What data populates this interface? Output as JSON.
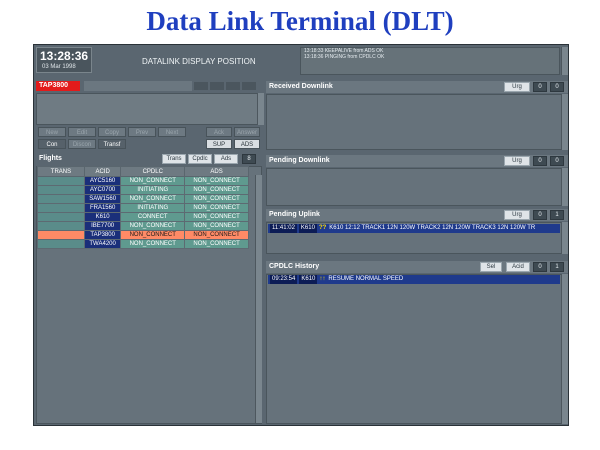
{
  "slide": {
    "title": "Data Link Terminal (DLT)"
  },
  "clock": {
    "time": "13:28:36",
    "date": "03 Mar 1998"
  },
  "display_title": "DATALINK DISPLAY POSITION",
  "log_lines": [
    "13:18:33 KEEPALIVE from ADS OK",
    "13:18:36 PINGING from CPDLC OK"
  ],
  "flight_tag": "TAP3800",
  "buttons": {
    "row1": [
      "New",
      "Edit",
      "Copy",
      "Prev",
      "Next"
    ],
    "row1_right": [
      "Ack",
      "Answer"
    ],
    "row2": [
      "Con",
      "Discon",
      "Transf"
    ],
    "row2_right": [
      "SUP",
      "ADS"
    ]
  },
  "flights": {
    "title": "Flights",
    "controls": [
      "Trans",
      "Cpdlc",
      "Ads"
    ],
    "count": "8",
    "columns": [
      "TRANS",
      "ACID",
      "CPDLC",
      "ADS"
    ],
    "rows": [
      {
        "trans": "",
        "acid": "AYC5160",
        "cpdlc": "NON_CONNECT",
        "ads": "NON_CONNECT",
        "selected": false
      },
      {
        "trans": "",
        "acid": "AYC0700",
        "cpdlc": "INITIATING",
        "ads": "NON_CONNECT",
        "selected": false
      },
      {
        "trans": "",
        "acid": "SAW1560",
        "cpdlc": "NON_CONNECT",
        "ads": "NON_CONNECT",
        "selected": false
      },
      {
        "trans": "",
        "acid": "FRA1560",
        "cpdlc": "INITIATING",
        "ads": "NON_CONNECT",
        "selected": false
      },
      {
        "trans": "",
        "acid": "K610",
        "cpdlc": "CONNECT",
        "ads": "NON_CONNECT",
        "selected": false
      },
      {
        "trans": "",
        "acid": "IBE7700",
        "cpdlc": "NON_CONNECT",
        "ads": "NON_CONNECT",
        "selected": false
      },
      {
        "trans": "",
        "acid": "TAP3800",
        "cpdlc": "NON_CONNECT",
        "ads": "NON_CONNECT",
        "selected": true
      },
      {
        "trans": "",
        "acid": "TWA4200",
        "cpdlc": "NON_CONNECT",
        "ads": "NON_CONNECT",
        "selected": false
      }
    ]
  },
  "received_downlink": {
    "title": "Received Downlink",
    "urg": "Urg",
    "counts": [
      "0",
      "0"
    ]
  },
  "pending_downlink": {
    "title": "Pending Downlink",
    "urg": "Urg",
    "counts": [
      "0",
      "0"
    ]
  },
  "pending_uplink": {
    "title": "Pending Uplink",
    "urg": "Urg",
    "counts": [
      "0",
      "1"
    ],
    "time": "11:41:02",
    "acid": "K610",
    "flag": "??",
    "message": "K610 12:12 TRACK1 12N 120W TRACK2 12N 120W TRACK3 12N 120W TR"
  },
  "cpdlc_history": {
    "title": "CPDLC History",
    "sel": "Sel",
    "acid_btn": "Acid",
    "counts": [
      "0",
      "1"
    ],
    "time": "09:23:54",
    "acid": "K610",
    "flag": "↑↑",
    "message": "RESUME NORMAL SPEED"
  },
  "colors": {
    "title": "#1f3fbf",
    "tag": "#e31b1b",
    "selected_row": "#ff8a66",
    "acid_cell": "#1a2f7a"
  }
}
